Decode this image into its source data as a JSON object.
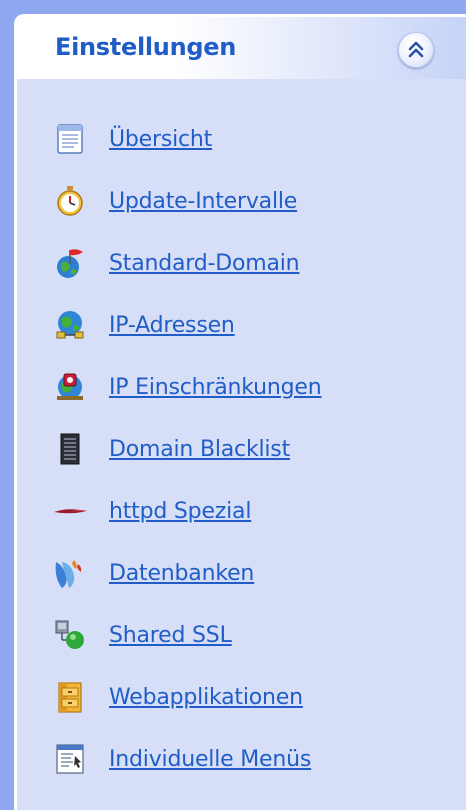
{
  "panel": {
    "title": "Einstellungen",
    "collapse_icon": "double-chevron-up-icon"
  },
  "items": [
    {
      "label": "Übersicht",
      "icon": "document-icon"
    },
    {
      "label": "Update-Intervalle",
      "icon": "stopwatch-icon"
    },
    {
      "label": "Standard-Domain",
      "icon": "globe-flag-icon"
    },
    {
      "label": "IP-Adressen",
      "icon": "globe-network-icon"
    },
    {
      "label": "IP Einschränkungen",
      "icon": "globe-restricted-icon"
    },
    {
      "label": "Domain Blacklist",
      "icon": "blacklist-server-icon"
    },
    {
      "label": "httpd Spezial",
      "icon": "feather-icon"
    },
    {
      "label": "Datenbanken",
      "icon": "database-icon"
    },
    {
      "label": "Shared SSL",
      "icon": "ssl-lock-icon"
    },
    {
      "label": "Webapplikationen",
      "icon": "cabinet-icon"
    },
    {
      "label": "Individuelle Menüs",
      "icon": "custom-menu-icon"
    }
  ],
  "colors": {
    "background": "#8fa9f0",
    "panel_body": "#d6dff7",
    "link": "#215dc6"
  }
}
